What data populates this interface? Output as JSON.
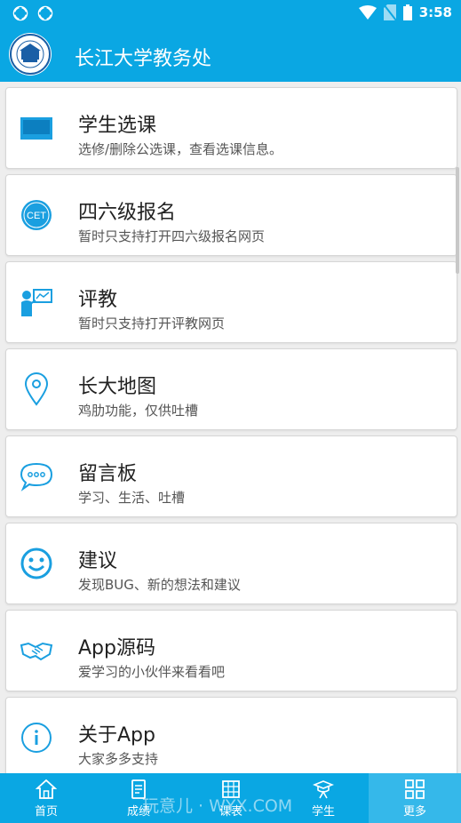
{
  "status_bar": {
    "time": "3:58"
  },
  "app_bar": {
    "title": "长江大学教务处"
  },
  "menu_items": [
    {
      "title": "学生选课",
      "desc": "选修/删除公选课，查看选课信息。",
      "icon": "blackboard-icon"
    },
    {
      "title": "四六级报名",
      "desc": "暂时只支持打开四六级报名网页",
      "icon": "cet-icon",
      "icon_text": "CET"
    },
    {
      "title": "评教",
      "desc": "暂时只支持打开评教网页",
      "icon": "teacher-icon"
    },
    {
      "title": "长大地图",
      "desc": "鸡肋功能，仅供吐槽",
      "icon": "map-pin-icon"
    },
    {
      "title": "留言板",
      "desc": "学习、生活、吐槽",
      "icon": "chat-bubble-icon"
    },
    {
      "title": "建议",
      "desc": "发现BUG、新的想法和建议",
      "icon": "smiley-icon"
    },
    {
      "title": "App源码",
      "desc": "爱学习的小伙伴来看看吧",
      "icon": "handshake-icon"
    },
    {
      "title": "关于App",
      "desc": "大家多多支持",
      "icon": "info-icon"
    }
  ],
  "bottom_nav": [
    {
      "label": "首页",
      "icon": "home-icon"
    },
    {
      "label": "成绩",
      "icon": "grades-icon"
    },
    {
      "label": "课表",
      "icon": "timetable-icon"
    },
    {
      "label": "学生",
      "icon": "student-icon"
    },
    {
      "label": "更多",
      "icon": "more-grid-icon",
      "active": true
    }
  ],
  "watermark": "玩意儿 · WYX.COM",
  "colors": {
    "primary": "#0aa7e3",
    "active_tab": "#35b8ea",
    "icon_blue": "#1a9fe0"
  }
}
